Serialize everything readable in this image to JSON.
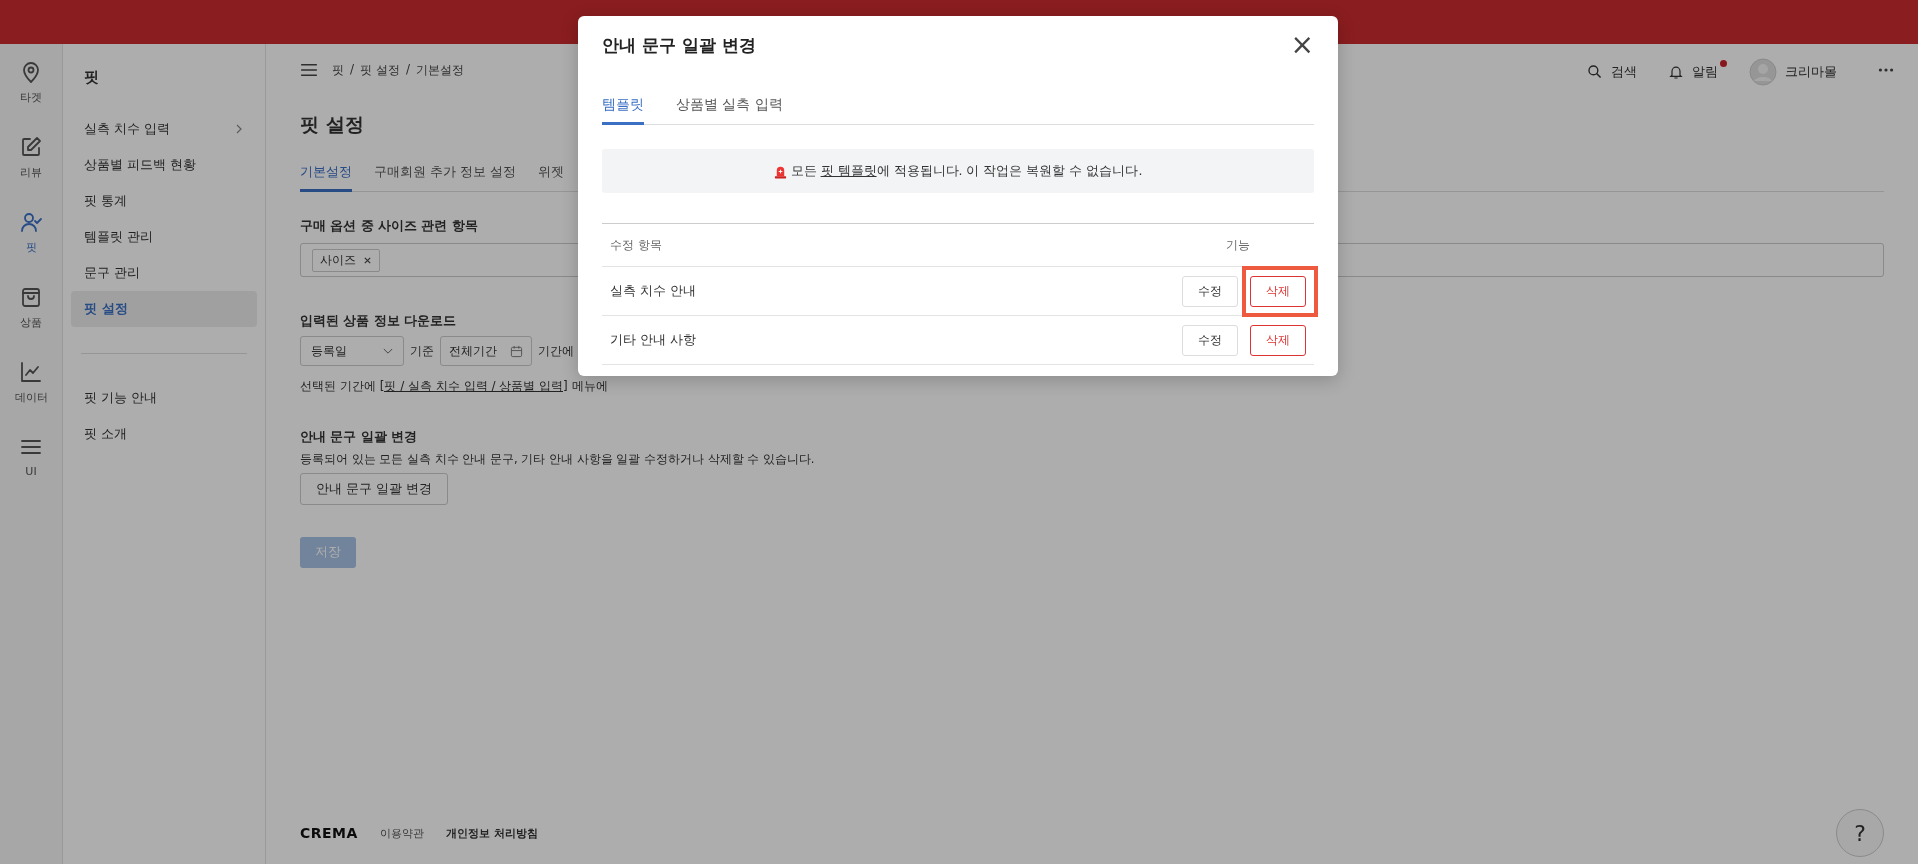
{
  "rail": [
    {
      "label": "타겟",
      "selected": false
    },
    {
      "label": "리뷰",
      "selected": false
    },
    {
      "label": "핏",
      "selected": true
    },
    {
      "label": "상품",
      "selected": false
    },
    {
      "label": "데이터",
      "selected": false
    },
    {
      "label": "UI",
      "selected": false
    }
  ],
  "sidebar": {
    "title": "핏",
    "items": [
      {
        "label": "실측 치수 입력",
        "has_submenu": true,
        "selected": false
      },
      {
        "label": "상품별 피드백 현황",
        "has_submenu": false,
        "selected": false
      },
      {
        "label": "핏 통계",
        "has_submenu": false,
        "selected": false
      },
      {
        "label": "템플릿 관리",
        "has_submenu": false,
        "selected": false
      },
      {
        "label": "문구 관리",
        "has_submenu": false,
        "selected": false
      },
      {
        "label": "핏 설정",
        "has_submenu": false,
        "selected": true
      }
    ],
    "extra_items": [
      "핏 기능 안내",
      "핏 소개"
    ]
  },
  "breadcrumb": [
    "핏",
    "핏 설정",
    "기본설정"
  ],
  "breadcrumb_separator": "/",
  "header": {
    "search": "검색",
    "alerts": "알림",
    "alerts_unread": true,
    "user": "크리마몰"
  },
  "page_title": "핏 설정",
  "tabs": [
    {
      "label": "기본설정",
      "selected": true
    },
    {
      "label": "구매회원 추가 정보 설정",
      "selected": false
    },
    {
      "label": "위젯",
      "selected": false
    }
  ],
  "size_section": {
    "label": "구매 옵션 중 사이즈 관련 항목",
    "tags": [
      "사이즈"
    ]
  },
  "download_section": {
    "label": "입력된 상품 정보 다운로드",
    "basis": "등록일",
    "basis_suffix": "기준",
    "period": "전체기간",
    "period_suffix": "기간에",
    "description_before": "선택된 기간에 ",
    "description_link": "[핏 / 실측 치수 입력 / 상품별 입력]",
    "description_after": " 메뉴에"
  },
  "bulk_section": {
    "label": "안내 문구 일괄 변경",
    "description": "등록되어 있는 모든 실측 치수 안내 문구, 기타 안내 사항을 일괄 수정하거나 삭제할 수 있습니다.",
    "button": "안내 문구 일괄 변경"
  },
  "save_button": {
    "label": "저장",
    "disabled": true
  },
  "footer": {
    "logo": "CREMA",
    "links": [
      {
        "label": "이용약관",
        "bold": false
      },
      {
        "label": "개인정보 처리방침",
        "bold": true
      }
    ],
    "help": "?"
  },
  "modal": {
    "title": "안내 문구 일괄 변경",
    "close": "×",
    "tabs": [
      {
        "label": "템플릿",
        "selected": true
      },
      {
        "label": "상품별 실측 입력",
        "selected": false
      }
    ],
    "notice": {
      "before": "모든 ",
      "link": "핏 템플릿",
      "after": "에 적용됩니다. 이 작업은 복원할 수 없습니다."
    },
    "columns": [
      "수정 항목",
      "기능"
    ],
    "rows": [
      {
        "name": "실측 치수 안내",
        "edit": "수정",
        "delete": "삭제",
        "highlighted": true
      },
      {
        "name": "기타 안내 사항",
        "edit": "수정",
        "delete": "삭제",
        "highlighted": false
      }
    ]
  }
}
